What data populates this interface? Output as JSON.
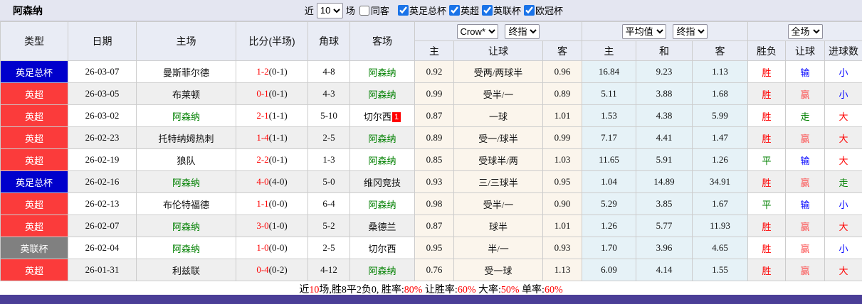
{
  "page": {
    "team": "阿森纳",
    "topbar": {
      "recent_prefix": "近",
      "recent_count": "10",
      "recent_suffix": "场",
      "same_away": {
        "label": "同客",
        "checked": false
      },
      "filters": [
        {
          "label": "英足总杯",
          "checked": true
        },
        {
          "label": "英超",
          "checked": true
        },
        {
          "label": "英联杯",
          "checked": true
        },
        {
          "label": "欧冠杯",
          "checked": true
        }
      ]
    }
  },
  "table": {
    "headers": {
      "type": "类型",
      "date": "日期",
      "home": "主场",
      "score": "比分(半场)",
      "corner": "角球",
      "away": "客场",
      "crow_home": "主",
      "crow_handicap": "让球",
      "crow_away": "客",
      "avg_home": "主",
      "avg_draw": "和",
      "avg_away": "客",
      "result_wdl": "胜负",
      "result_handicap": "让球",
      "result_goals": "进球数"
    },
    "selects": {
      "crow_source": "Crow*",
      "crow_stage": "终指",
      "avg_source": "平均值",
      "avg_stage": "终指",
      "scope": "全场"
    },
    "rows": [
      {
        "league": "英足总杯",
        "league_color": "blue",
        "date": "26-03-07",
        "home": "曼斯菲尔德",
        "home_highlight": false,
        "score": "1-2",
        "half": "(0-1)",
        "corner": "4-8",
        "away": "阿森纳",
        "away_highlight": true,
        "away_card": "",
        "crow": [
          "0.92",
          "受两/两球半",
          "0.96"
        ],
        "avg": [
          "16.84",
          "9.23",
          "1.13"
        ],
        "wdl": {
          "text": "胜",
          "color": "red"
        },
        "handicap_result": {
          "text": "输",
          "color": "blue"
        },
        "goals_result": {
          "text": "小",
          "color": "blue"
        }
      },
      {
        "league": "英超",
        "league_color": "red",
        "date": "26-03-05",
        "home": "布莱顿",
        "home_highlight": false,
        "score": "0-1",
        "half": "(0-1)",
        "corner": "4-3",
        "away": "阿森纳",
        "away_highlight": true,
        "away_card": "",
        "crow": [
          "0.99",
          "受半/一",
          "0.89"
        ],
        "avg": [
          "5.11",
          "3.88",
          "1.68"
        ],
        "wdl": {
          "text": "胜",
          "color": "red"
        },
        "handicap_result": {
          "text": "赢",
          "color": "red2"
        },
        "goals_result": {
          "text": "小",
          "color": "blue"
        }
      },
      {
        "league": "英超",
        "league_color": "red",
        "date": "26-03-02",
        "home": "阿森纳",
        "home_highlight": true,
        "score": "2-1",
        "half": "(1-1)",
        "corner": "5-10",
        "away": "切尔西",
        "away_highlight": false,
        "away_card": "1",
        "crow": [
          "0.87",
          "一球",
          "1.01"
        ],
        "avg": [
          "1.53",
          "4.38",
          "5.99"
        ],
        "wdl": {
          "text": "胜",
          "color": "red"
        },
        "handicap_result": {
          "text": "走",
          "color": "green"
        },
        "goals_result": {
          "text": "大",
          "color": "red"
        }
      },
      {
        "league": "英超",
        "league_color": "red",
        "date": "26-02-23",
        "home": "托特纳姆热刺",
        "home_highlight": false,
        "score": "1-4",
        "half": "(1-1)",
        "corner": "2-5",
        "away": "阿森纳",
        "away_highlight": true,
        "away_card": "",
        "crow": [
          "0.89",
          "受一/球半",
          "0.99"
        ],
        "avg": [
          "7.17",
          "4.41",
          "1.47"
        ],
        "wdl": {
          "text": "胜",
          "color": "red"
        },
        "handicap_result": {
          "text": "赢",
          "color": "red2"
        },
        "goals_result": {
          "text": "大",
          "color": "red"
        }
      },
      {
        "league": "英超",
        "league_color": "red",
        "date": "26-02-19",
        "home": "狼队",
        "home_highlight": false,
        "score": "2-2",
        "half": "(0-1)",
        "corner": "1-3",
        "away": "阿森纳",
        "away_highlight": true,
        "away_card": "",
        "crow": [
          "0.85",
          "受球半/两",
          "1.03"
        ],
        "avg": [
          "11.65",
          "5.91",
          "1.26"
        ],
        "wdl": {
          "text": "平",
          "color": "green"
        },
        "handicap_result": {
          "text": "输",
          "color": "blue"
        },
        "goals_result": {
          "text": "大",
          "color": "red"
        }
      },
      {
        "league": "英足总杯",
        "league_color": "blue",
        "date": "26-02-16",
        "home": "阿森纳",
        "home_highlight": true,
        "score": "4-0",
        "half": "(4-0)",
        "corner": "5-0",
        "away": "维冈竞技",
        "away_highlight": false,
        "away_card": "",
        "crow": [
          "0.93",
          "三/三球半",
          "0.95"
        ],
        "avg": [
          "1.04",
          "14.89",
          "34.91"
        ],
        "wdl": {
          "text": "胜",
          "color": "red"
        },
        "handicap_result": {
          "text": "赢",
          "color": "red2"
        },
        "goals_result": {
          "text": "走",
          "color": "green"
        }
      },
      {
        "league": "英超",
        "league_color": "red",
        "date": "26-02-13",
        "home": "布伦特福德",
        "home_highlight": false,
        "score": "1-1",
        "half": "(0-0)",
        "corner": "6-4",
        "away": "阿森纳",
        "away_highlight": true,
        "away_card": "",
        "crow": [
          "0.98",
          "受半/一",
          "0.90"
        ],
        "avg": [
          "5.29",
          "3.85",
          "1.67"
        ],
        "wdl": {
          "text": "平",
          "color": "green"
        },
        "handicap_result": {
          "text": "输",
          "color": "blue"
        },
        "goals_result": {
          "text": "小",
          "color": "blue"
        }
      },
      {
        "league": "英超",
        "league_color": "red",
        "date": "26-02-07",
        "home": "阿森纳",
        "home_highlight": true,
        "score": "3-0",
        "half": "(1-0)",
        "corner": "5-2",
        "away": "桑德兰",
        "away_highlight": false,
        "away_card": "",
        "crow": [
          "0.87",
          "球半",
          "1.01"
        ],
        "avg": [
          "1.26",
          "5.77",
          "11.93"
        ],
        "wdl": {
          "text": "胜",
          "color": "red"
        },
        "handicap_result": {
          "text": "赢",
          "color": "red2"
        },
        "goals_result": {
          "text": "大",
          "color": "red"
        }
      },
      {
        "league": "英联杯",
        "league_color": "gray",
        "date": "26-02-04",
        "home": "阿森纳",
        "home_highlight": true,
        "score": "1-0",
        "half": "(0-0)",
        "corner": "2-5",
        "away": "切尔西",
        "away_highlight": false,
        "away_card": "",
        "crow": [
          "0.95",
          "半/一",
          "0.93"
        ],
        "avg": [
          "1.70",
          "3.96",
          "4.65"
        ],
        "wdl": {
          "text": "胜",
          "color": "red"
        },
        "handicap_result": {
          "text": "赢",
          "color": "red2"
        },
        "goals_result": {
          "text": "小",
          "color": "blue"
        }
      },
      {
        "league": "英超",
        "league_color": "red",
        "date": "26-01-31",
        "home": "利兹联",
        "home_highlight": false,
        "score": "0-4",
        "half": "(0-2)",
        "corner": "4-12",
        "away": "阿森纳",
        "away_highlight": true,
        "away_card": "",
        "crow": [
          "0.76",
          "受一球",
          "1.13"
        ],
        "avg": [
          "6.09",
          "4.14",
          "1.55"
        ],
        "wdl": {
          "text": "胜",
          "color": "red"
        },
        "handicap_result": {
          "text": "赢",
          "color": "red2"
        },
        "goals_result": {
          "text": "大",
          "color": "red"
        }
      }
    ]
  },
  "summary": {
    "segments": [
      {
        "text": "近",
        "color": "black"
      },
      {
        "text": "10",
        "color": "red"
      },
      {
        "text": "场,胜8平2负0, 胜率:",
        "color": "black"
      },
      {
        "text": "80%",
        "color": "red"
      },
      {
        "text": " 让胜率:",
        "color": "black"
      },
      {
        "text": "60%",
        "color": "red"
      },
      {
        "text": " 大率:",
        "color": "black"
      },
      {
        "text": "50%",
        "color": "red"
      },
      {
        "text": " 单率:",
        "color": "black"
      },
      {
        "text": "60%",
        "color": "red"
      }
    ]
  },
  "colors": {
    "league_blue": "#0000cc",
    "league_red": "#fb3b3b",
    "league_gray": "#808080",
    "team_green": "#008000",
    "score_red": "#ff0000",
    "result_red": "#ff0000",
    "result_red2": "#fb5252",
    "result_blue": "#0000ff",
    "result_green": "#008000",
    "crow_bg": "#fbf5ec",
    "avg_bg": "#e6f2f7",
    "bottom_bar": "#4b3e97"
  }
}
